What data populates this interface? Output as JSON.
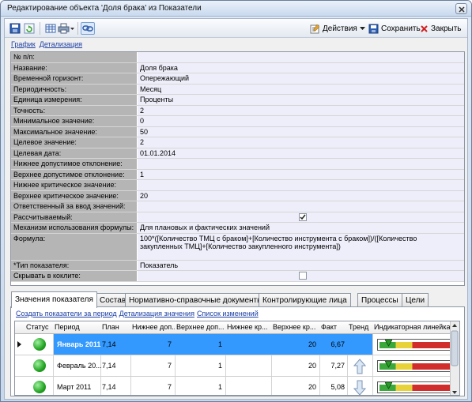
{
  "window": {
    "title": "Редактирование объекта 'Доля брака' из Показатели"
  },
  "toolbar": {
    "actions_label": "Действия",
    "save_label": "Сохранить",
    "close_label": "Закрыть"
  },
  "links": {
    "chart": "График",
    "detail": "Детализация"
  },
  "properties": [
    {
      "label": "№ п/п:",
      "value": ""
    },
    {
      "label": "Название:",
      "value": "Доля брака"
    },
    {
      "label": "Временной горизонт:",
      "value": "Опережающий"
    },
    {
      "label": "Периодичность:",
      "value": "Месяц"
    },
    {
      "label": "Единица измерения:",
      "value": "Проценты"
    },
    {
      "label": "Точность:",
      "value": "2"
    },
    {
      "label": "Минимальное значение:",
      "value": "0"
    },
    {
      "label": "Максимальное значение:",
      "value": "50"
    },
    {
      "label": "Целевое значение:",
      "value": "2"
    },
    {
      "label": "Целевая дата:",
      "value": "01.01.2014"
    },
    {
      "label": "Нижнее допустимое отклонение:",
      "value": ""
    },
    {
      "label": "Верхнее допустимое отклонение:",
      "value": "1"
    },
    {
      "label": "Нижнее критическое значение:",
      "value": ""
    },
    {
      "label": "Верхнее критическое значение:",
      "value": "20"
    },
    {
      "label": "Ответственный за ввод значений:",
      "value": ""
    },
    {
      "label": "Рассчитываемый:",
      "value": "",
      "checked": true
    },
    {
      "label": "Механизм использования формулы:",
      "value": "Для плановых и фактических значений"
    },
    {
      "label": "Формула:",
      "value": "100*([Количество ТМЦ с браком]+[Количество инструмента с браком])/([Количество закупленных ТМЦ]+[Количество закупленного инструмента])"
    },
    {
      "label": "*Тип показателя:",
      "value": "Показатель"
    },
    {
      "label": "Скрывать в коклите:",
      "value": "",
      "checked": false
    }
  ],
  "tabs": [
    "Значения показателя",
    "Состав",
    "Нормативно-справочные документы",
    "Контролирующие лица",
    "Процессы",
    "Цели"
  ],
  "tab_links": {
    "create": "Создать показатели за период",
    "detail": "Детализация значения",
    "tasks": "Список изменений"
  },
  "grid": {
    "columns": [
      "Статус",
      "Период",
      "План",
      "Нижнее доп...",
      "Верхнее доп...",
      "Нижнее кр...",
      "Верхнее кр...",
      "Факт",
      "Тренд",
      "Индикаторная линейка"
    ],
    "rows": [
      {
        "period": "Январь 2011",
        "plan": "7,14",
        "lower_dev": "7",
        "upper_dev": "1",
        "lower_crit": "",
        "upper_crit": "20",
        "fact": "6,67",
        "trend": "none",
        "indicator": 0.12
      },
      {
        "period": "Февраль 20...",
        "plan": "7,14",
        "lower_dev": "7",
        "upper_dev": "1",
        "lower_crit": "",
        "upper_crit": "20",
        "fact": "7,27",
        "trend": "up",
        "indicator": 0.12
      },
      {
        "period": "Март 2011",
        "plan": "7,14",
        "lower_dev": "7",
        "upper_dev": "1",
        "lower_crit": "",
        "upper_crit": "20",
        "fact": "5,08",
        "trend": "down",
        "indicator": 0.12
      }
    ]
  },
  "colors": {
    "selection": "#3399ff",
    "label_bg": "#b5b5b5",
    "value_bg": "#eeeefa",
    "status_green": "#22a322"
  }
}
